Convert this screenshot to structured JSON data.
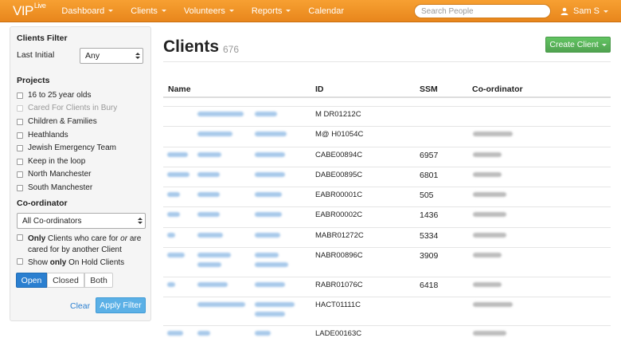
{
  "nav": {
    "brand": "VIP",
    "brand_sup": "Live",
    "items": [
      {
        "label": "Dashboard",
        "dropdown": true
      },
      {
        "label": "Clients",
        "dropdown": true
      },
      {
        "label": "Volunteers",
        "dropdown": true
      },
      {
        "label": "Reports",
        "dropdown": true
      },
      {
        "label": "Calendar",
        "dropdown": false
      }
    ],
    "search_placeholder": "Search People",
    "user": "Sam S",
    "accent": "#f09428"
  },
  "filter": {
    "title": "Clients Filter",
    "last_initial_label": "Last Initial",
    "last_initial_value": "Any",
    "projects_title": "Projects",
    "projects": [
      {
        "label": "16 to 25 year olds",
        "disabled": false
      },
      {
        "label": "Cared For Clients in Bury",
        "disabled": true
      },
      {
        "label": "Children & Families",
        "disabled": false
      },
      {
        "label": "Heathlands",
        "disabled": false
      },
      {
        "label": "Jewish Emergency Team",
        "disabled": false
      },
      {
        "label": "Keep in the loop",
        "disabled": false
      },
      {
        "label": "North Manchester",
        "disabled": false
      },
      {
        "label": "South Manchester",
        "disabled": false
      }
    ],
    "coordinator_title": "Co-ordinator",
    "coordinator_value": "All Co-ordinators",
    "only_bold": "Only",
    "only_rest_1": " Clients who care for ",
    "only_italic": "or",
    "only_rest_2": " are",
    "only_line2": "cared for by another Client",
    "onhold_pre": "Show ",
    "onhold_bold": "only",
    "onhold_post": " On Hold Clients",
    "status_buttons": [
      "Open",
      "Closed",
      "Both"
    ],
    "status_active": "Open",
    "clear_label": "Clear",
    "apply_label": "Apply Filter"
  },
  "main": {
    "title": "Clients",
    "count": "676",
    "create_label": "Create Client",
    "columns": [
      "Name",
      "ID",
      "SSM",
      "Co-ordinator"
    ],
    "rows": [
      {
        "id": "M DR01212C",
        "ssm": ""
      },
      {
        "id": "M@ H01054C",
        "ssm": ""
      },
      {
        "id": "CABE00894C",
        "ssm": "6957"
      },
      {
        "id": "DABE00895C",
        "ssm": "6801"
      },
      {
        "id": "EABR00001C",
        "ssm": "505"
      },
      {
        "id": "EABR00002C",
        "ssm": "1436"
      },
      {
        "id": "MABR01272C",
        "ssm": "5334"
      },
      {
        "id": "NABR00896C",
        "ssm": "3909"
      },
      {
        "id": "RABR01076C",
        "ssm": "6418"
      },
      {
        "id": "HACT01111C",
        "ssm": ""
      },
      {
        "id": "LADE00163C",
        "ssm": ""
      }
    ]
  }
}
